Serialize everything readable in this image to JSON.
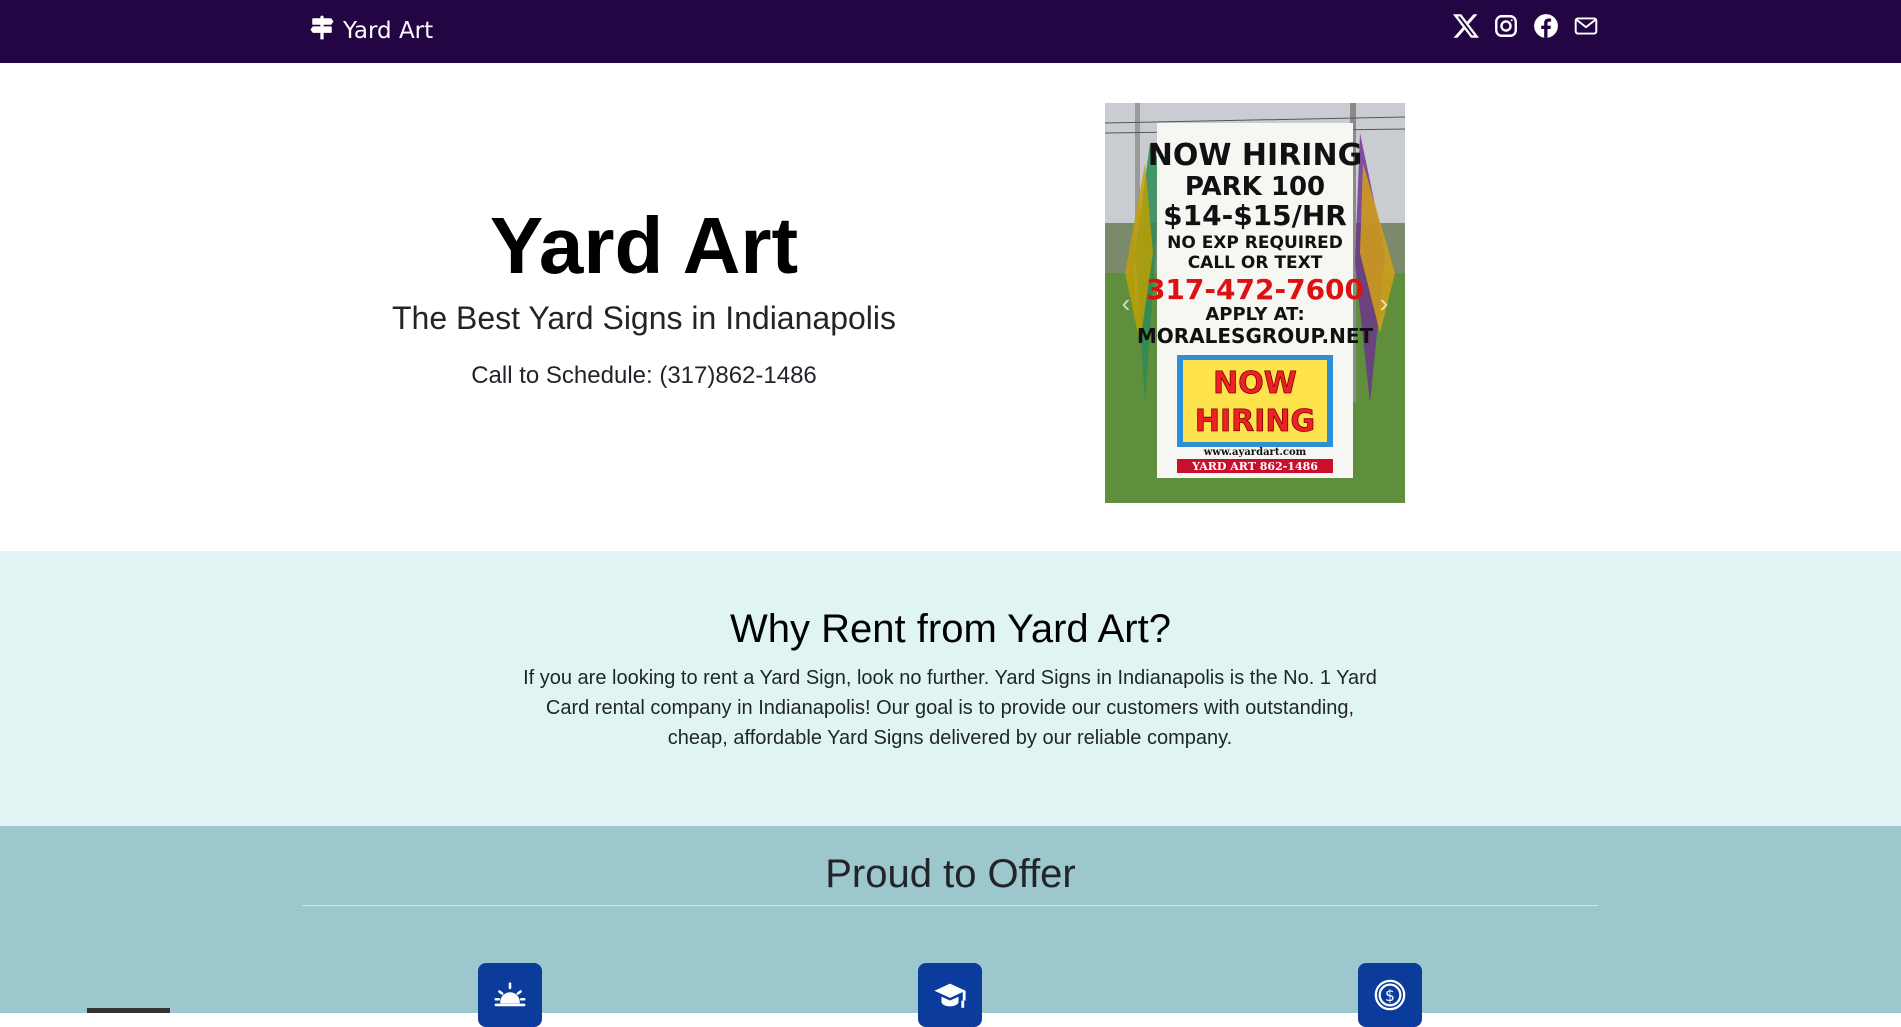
{
  "nav": {
    "brand_icon": "signpost-icon",
    "brand": "Yard Art",
    "social": [
      {
        "name": "x-twitter-icon"
      },
      {
        "name": "instagram-icon"
      },
      {
        "name": "facebook-icon"
      },
      {
        "name": "envelope-icon"
      }
    ]
  },
  "hero": {
    "title": "Yard Art",
    "subtitle": "The Best Yard Signs in Indianapolis",
    "call": "Call to Schedule: (317)862-1486",
    "carousel": {
      "prev_icon": "chevron-left-icon",
      "next_icon": "chevron-right-icon",
      "sign_lines": [
        "NOW HIRING",
        "PARK 100",
        "$14-$15/HR",
        "NO EXP REQUIRED",
        "CALL OR TEXT",
        "317-472-7600",
        "APPLY AT:",
        "MORALESGROUP.NET",
        "NOW",
        "HIRING",
        "www.ayardart.com",
        "YARD ART 862-1486"
      ]
    }
  },
  "why": {
    "heading": "Why Rent from Yard Art?",
    "line1": "If you are looking to rent a Yard Sign, look no further. Yard Signs in Indianapolis is the No. 1 Yard",
    "line2": "Card rental company in Indianapolis! Our goal is to provide our customers with outstanding,",
    "line3": "cheap, affordable Yard Signs delivered by our reliable company."
  },
  "offer": {
    "heading": "Proud to Offer",
    "features": [
      {
        "icon": "sunrise-icon"
      },
      {
        "icon": "graduation-cap-icon"
      },
      {
        "icon": "dollar-coin-icon"
      }
    ]
  },
  "colors": {
    "navbar": "#230544",
    "why_bg": "#e0f5f3",
    "offer_bg": "#9cc7cc",
    "feature_icon_bg": "#0b3c9c"
  }
}
